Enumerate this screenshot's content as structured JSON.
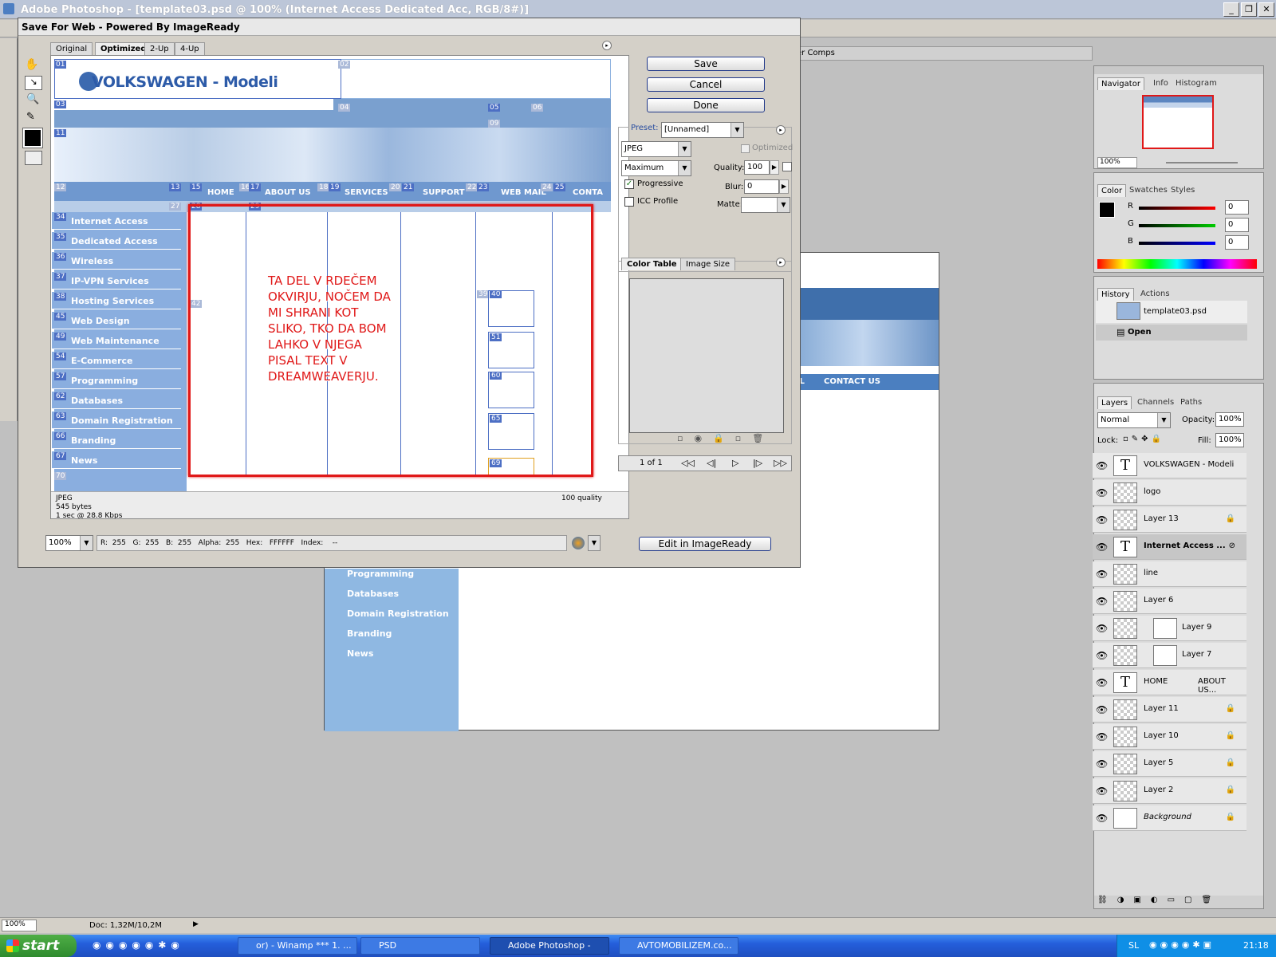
{
  "app": {
    "title": "Adobe Photoshop - [template03.psd @ 100% (Internet Access  Dedicated Acc, RGB/8#)]",
    "comps_tab": "er Comps"
  },
  "dialog": {
    "title": "Save For Web - Powered By ImageReady",
    "tabs": [
      "Original",
      "Optimized",
      "2-Up",
      "4-Up"
    ],
    "buttons": {
      "save": "Save",
      "cancel": "Cancel",
      "done": "Done",
      "edit": "Edit in ImageReady"
    },
    "preset_label": "Preset:",
    "preset_value": "[Unnamed]",
    "format": "JPEG",
    "quality_level": "Maximum",
    "optimized_label": "Optimized",
    "quality_label": "Quality:",
    "quality_value": "100",
    "blur_label": "Blur:",
    "blur_value": "0",
    "matte_label": "Matte:",
    "progressive_label": "Progressive",
    "icc_label": "ICC Profile",
    "color_table_tab": "Color Table",
    "image_size_tab": "Image Size",
    "page_counter": "1 of 1",
    "info": {
      "line1": "JPEG",
      "line2": "545 bytes",
      "line3": "1 sec @ 28.8 Kbps",
      "quality_text": "100 quality"
    },
    "status": {
      "zoom": "100%",
      "readout": "R:  255   G:  255   B:  255   Alpha:  255   Hex:   FFFFFF   Index:    --"
    }
  },
  "preview": {
    "logo": "VOLKSWAGEN",
    "logo_suffix": " - Modeli",
    "nav": [
      "HOME",
      "ABOUT US",
      "SERVICES",
      "SUPPORT",
      "WEB MAIL",
      "CONTA"
    ],
    "menu": [
      "Internet Access",
      "Dedicated Access",
      "Wireless",
      "IP-VPN Services",
      "Hosting Services",
      "Web Design",
      "Web Maintenance",
      "E-Commerce",
      "Programming",
      "Databases",
      "Domain Registration",
      "Branding",
      "News"
    ],
    "menu_slices": [
      "34",
      "35",
      "36",
      "37",
      "38",
      "45",
      "49",
      "54",
      "57",
      "62",
      "63",
      "66",
      "67"
    ],
    "annotation": [
      "TA DEL V RDEČEM",
      "OKVIRJU, NOČEM DA",
      "MI SHRANI KOT",
      "SLIKO, TKO DA BOM",
      "LAHKO V NJEGA",
      "PISAL TEXT V",
      "DREAMWEAVERJU."
    ],
    "slice_labels": {
      "s01": "01",
      "s02": "02",
      "s03": "03",
      "s04": "04",
      "s05": "05",
      "s06": "06",
      "s09": "09",
      "s11": "11",
      "s12": "12",
      "s13": "13",
      "s15": "15",
      "s16": "16",
      "s17": "17",
      "s18": "18",
      "s19": "19",
      "s20": "20",
      "s21": "21",
      "s22": "22",
      "s23": "23",
      "s24": "24",
      "s25": "25",
      "s27": "27",
      "s28": "28",
      "s29": "29",
      "s39": "39",
      "s40": "40",
      "s42": "42",
      "s51": "51",
      "s60": "60",
      "s65": "65",
      "s69": "69",
      "s70": "70"
    }
  },
  "canvas": {
    "menu": [
      "Programming",
      "Databases",
      "Domain Registration",
      "Branding",
      "News"
    ],
    "nav_right": "AIL",
    "contact": "CONTACT US"
  },
  "navigator": {
    "tabs": [
      "Navigator",
      "Info",
      "Histogram"
    ],
    "zoom": "100%"
  },
  "color_panel": {
    "tabs": [
      "Color",
      "Swatches",
      "Styles"
    ],
    "r": "0",
    "g": "0",
    "b": "0",
    "r_label": "R",
    "g_label": "G",
    "b_label": "B"
  },
  "history": {
    "tabs": [
      "History",
      "Actions"
    ],
    "items": [
      "template03.psd",
      "Open"
    ]
  },
  "layers": {
    "tabs": [
      "Layers",
      "Channels",
      "Paths"
    ],
    "blend": "Normal",
    "opacity_label": "Opacity:",
    "opacity": "100%",
    "lock_label": "Lock:",
    "fill_label": "Fill:",
    "fill": "100%",
    "items": [
      {
        "name": "VOLKSWAGEN - Modeli",
        "kind": "text"
      },
      {
        "name": "logo",
        "kind": "pixel"
      },
      {
        "name": "Layer 13",
        "kind": "pixel"
      },
      {
        "name": "Internet Access  ...",
        "kind": "text"
      },
      {
        "name": "line",
        "kind": "pixel"
      },
      {
        "name": "Layer 6",
        "kind": "pixel"
      },
      {
        "name": "Layer 9",
        "kind": "pixel"
      },
      {
        "name": "Layer 7",
        "kind": "pixel"
      },
      {
        "name": "HOME",
        "kind": "text",
        "extra": "ABOUT US..."
      },
      {
        "name": "Layer 11",
        "kind": "pixel"
      },
      {
        "name": "Layer 10",
        "kind": "pixel"
      },
      {
        "name": "Layer 5",
        "kind": "pixel"
      },
      {
        "name": "Layer 2",
        "kind": "pixel"
      },
      {
        "name": "Background",
        "kind": "pixel"
      }
    ]
  },
  "statusbar": {
    "zoom": "100%",
    "doc": "Doc: 1,32M/10,2M"
  },
  "taskbar": {
    "start": "start",
    "items": [
      "or) - Winamp *** 1. ...",
      "PSD",
      "Adobe Photoshop - [t...",
      "AVTOMOBILIZEM.co..."
    ],
    "lang": "SL",
    "time": "21:18"
  }
}
